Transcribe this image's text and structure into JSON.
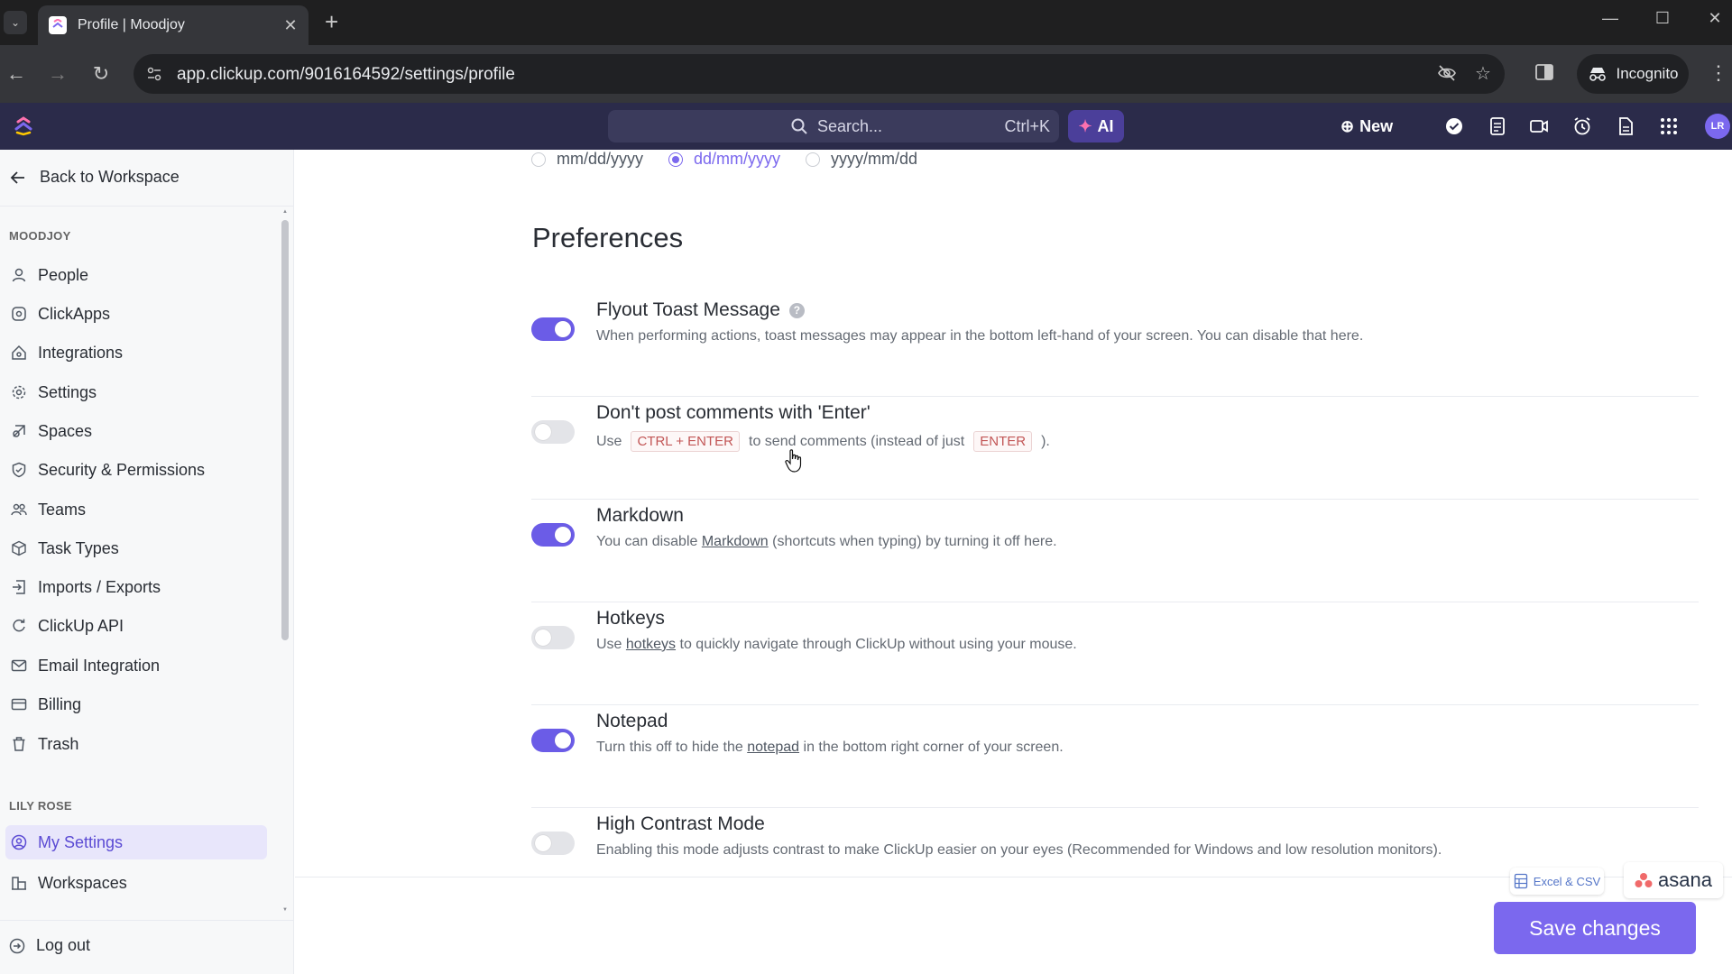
{
  "browser": {
    "tab_title": "Profile | Moodjoy",
    "url": "app.clickup.com/9016164592/settings/profile",
    "incognito_label": "Incognito"
  },
  "appbar": {
    "search_placeholder": "Search...",
    "search_shortcut": "Ctrl+K",
    "ai_label": "AI",
    "new_label": "New",
    "avatar_initials": "LR"
  },
  "sidebar": {
    "back_label": "Back to Workspace",
    "workspace_section": "MOODJOY",
    "workspace_items": [
      {
        "label": "People",
        "icon": "person-icon"
      },
      {
        "label": "ClickApps",
        "icon": "clickapps-icon"
      },
      {
        "label": "Integrations",
        "icon": "integrations-icon"
      },
      {
        "label": "Settings",
        "icon": "gear-icon"
      },
      {
        "label": "Spaces",
        "icon": "spaces-icon"
      },
      {
        "label": "Security & Permissions",
        "icon": "shield-icon"
      },
      {
        "label": "Teams",
        "icon": "teams-icon"
      },
      {
        "label": "Task Types",
        "icon": "cube-icon"
      },
      {
        "label": "Imports / Exports",
        "icon": "import-icon"
      },
      {
        "label": "ClickUp API",
        "icon": "api-icon"
      },
      {
        "label": "Email Integration",
        "icon": "mail-icon"
      },
      {
        "label": "Billing",
        "icon": "card-icon"
      },
      {
        "label": "Trash",
        "icon": "trash-icon"
      }
    ],
    "user_section": "LILY ROSE",
    "user_items": [
      {
        "label": "My Settings",
        "icon": "user-circle-icon",
        "active": true
      },
      {
        "label": "Workspaces",
        "icon": "workspaces-icon",
        "active": false
      }
    ],
    "logout_label": "Log out"
  },
  "date_format": {
    "options": [
      "mm/dd/yyyy",
      "dd/mm/yyyy",
      "yyyy/mm/dd"
    ],
    "selected": "dd/mm/yyyy"
  },
  "preferences": {
    "title": "Preferences",
    "flyout": {
      "name": "Flyout Toast Message",
      "desc": "When performing actions, toast messages may appear in the bottom left-hand of your screen. You can disable that here.",
      "enabled": true
    },
    "enter": {
      "name": "Don't post comments with 'Enter'",
      "desc_1": "Use",
      "kbd_1": "CTRL + ENTER",
      "desc_2": "to send comments (instead of just",
      "kbd_2": "ENTER",
      "desc_3": ").",
      "enabled": false
    },
    "markdown": {
      "name": "Markdown",
      "desc_1": "You can disable",
      "link": "Markdown",
      "desc_2": "(shortcuts when typing) by turning it off here.",
      "enabled": true
    },
    "hotkeys": {
      "name": "Hotkeys",
      "desc_1": "Use",
      "link": "hotkeys",
      "desc_2": "to quickly navigate through ClickUp without using your mouse.",
      "enabled": false
    },
    "notepad": {
      "name": "Notepad",
      "desc_1": "Turn this off to hide the",
      "link": "notepad",
      "desc_2": "in the bottom right corner of your screen.",
      "enabled": true
    },
    "contrast": {
      "name": "High Contrast Mode",
      "desc": "Enabling this mode adjusts contrast to make ClickUp easier on your eyes (Recommended for Windows and low resolution monitors).",
      "enabled": false
    }
  },
  "footer": {
    "excel_label": "Excel & CSV",
    "asana_label": "asana",
    "save_label": "Save changes"
  },
  "colors": {
    "accent": "#7b68ee",
    "appbar": "#2b2b4a",
    "toggle_on": "#6b5ce7"
  }
}
